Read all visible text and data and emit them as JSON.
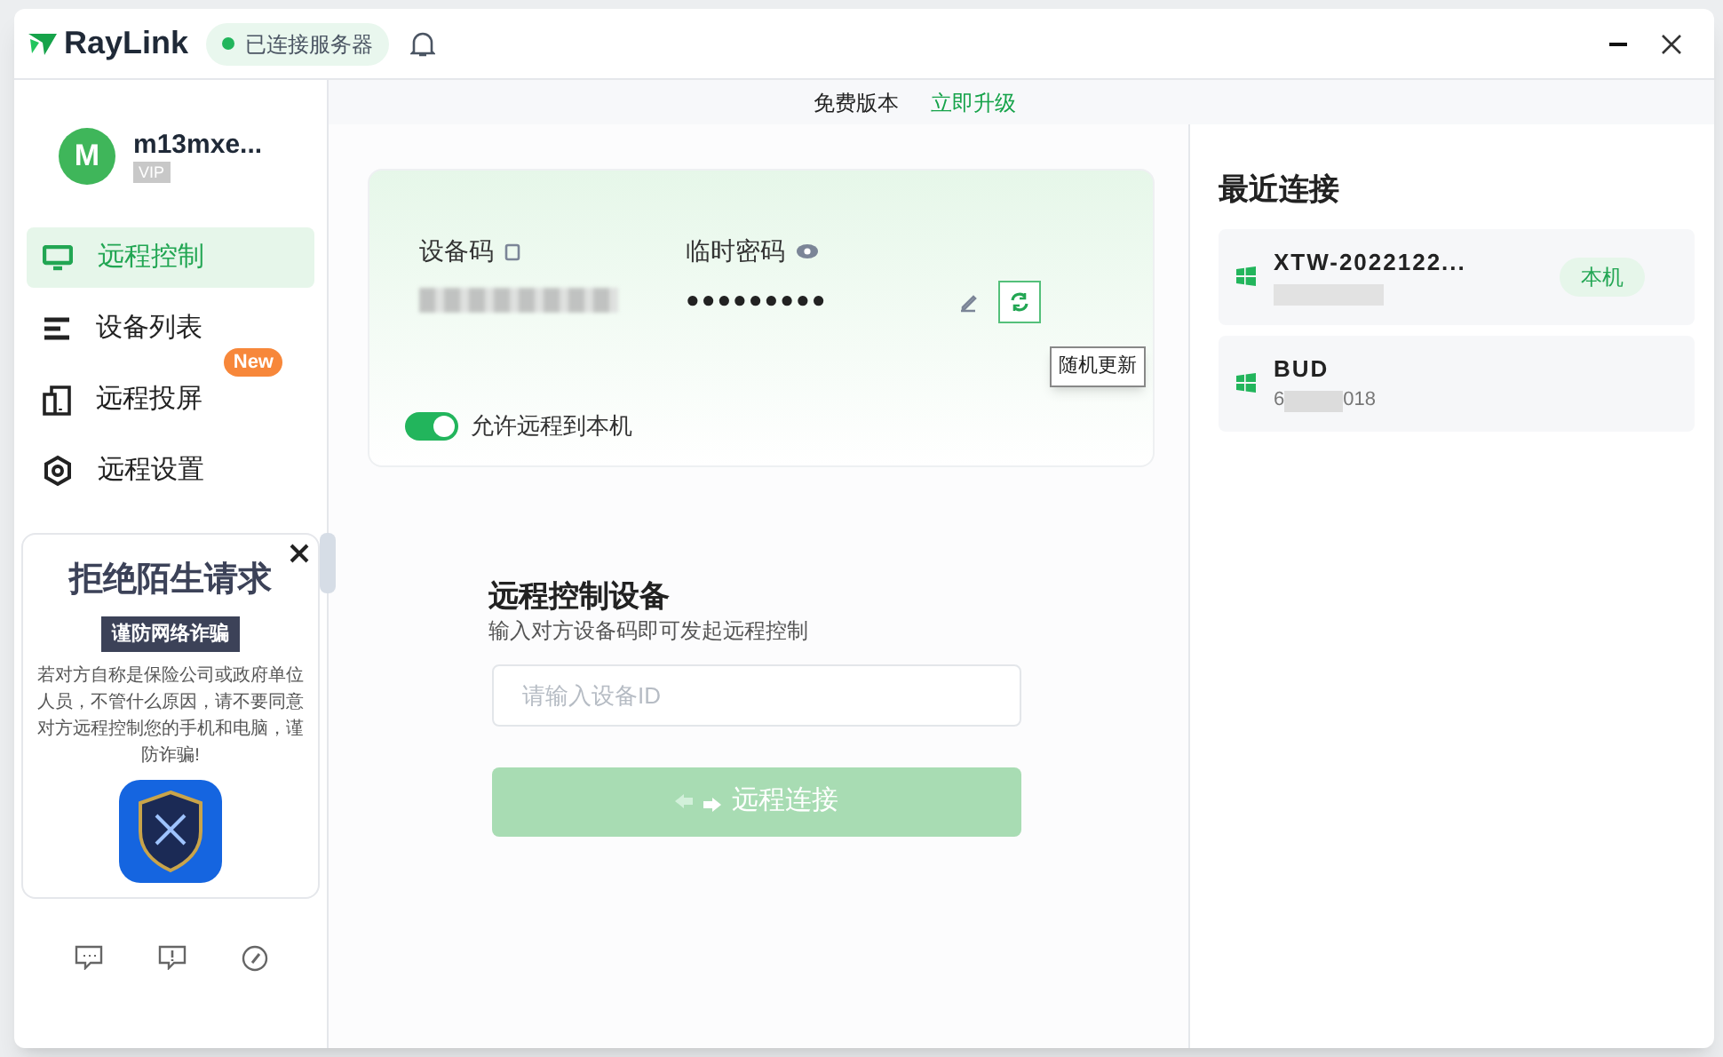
{
  "app": {
    "logo": "RayLink",
    "server_status": {
      "label": "已连接服务器",
      "connected": true
    }
  },
  "user": {
    "avatar": "M",
    "name": "m13mxe...",
    "badge": "VIP"
  },
  "sidebar": {
    "items": [
      {
        "label": "远程控制",
        "selected": true,
        "kind": "monitor"
      },
      {
        "label": "设备列表",
        "selected": false,
        "kind": "list"
      },
      {
        "label": "远程投屏",
        "selected": false,
        "kind": "cast",
        "badge": "New"
      },
      {
        "label": "远程设置",
        "selected": false,
        "kind": "settings"
      }
    ]
  },
  "promo": {
    "title": "拒绝陌生请求",
    "subtitle": "谨防网络诈骗",
    "text": "若对方自称是保险公司或政府单位人员，不管什么原因，请不要同意对方远程控制您的手机和电脑，谨防诈骗!"
  },
  "plan": {
    "label": "免费版本",
    "upgrade": "立即升级"
  },
  "device_card": {
    "code_label": "设备码",
    "password_label": "临时密码",
    "password": "●●●●●●●●●",
    "tooltip": "随机更新",
    "allow_remote": {
      "label": "允许远程到本机",
      "on": true
    }
  },
  "connect": {
    "title": "远程控制设备",
    "subtitle": "输入对方设备码即可发起远程控制",
    "placeholder": "请输入设备ID",
    "button": "远程连接",
    "disabled": true
  },
  "recent": {
    "title": "最近连接",
    "items": [
      {
        "name": "XTW-2022122...",
        "tag": "本机"
      },
      {
        "name": "BUD",
        "id_start": "6",
        "id_end": "018"
      }
    ]
  }
}
